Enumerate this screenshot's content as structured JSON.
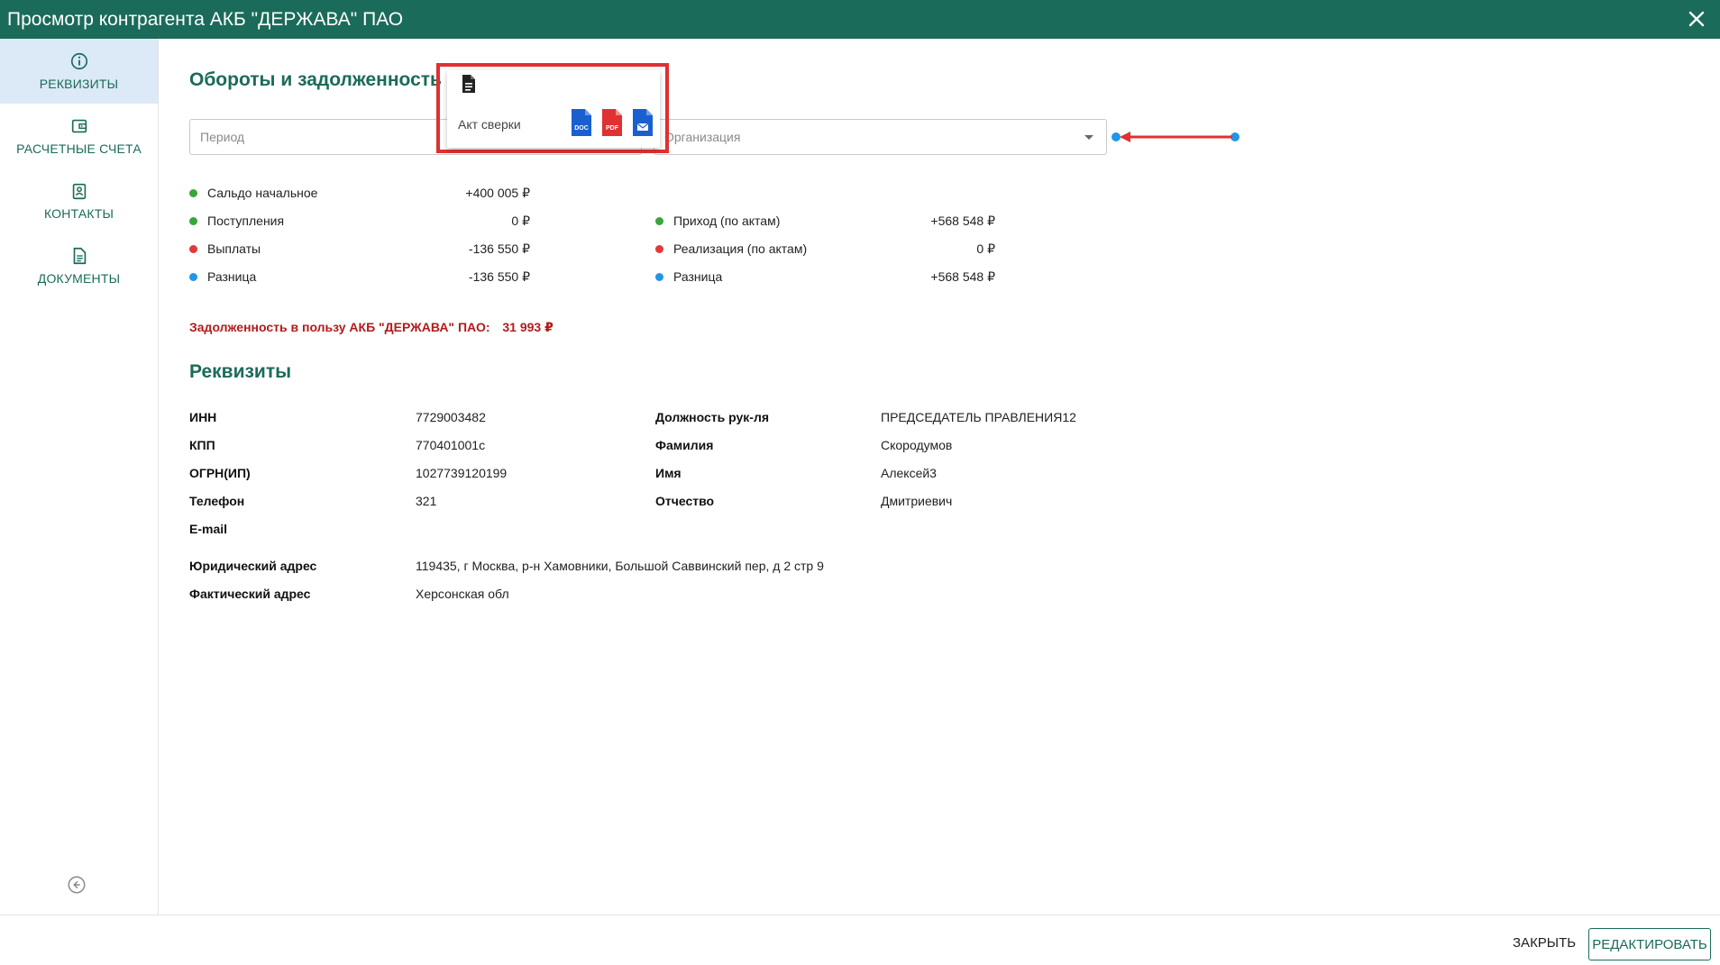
{
  "window": {
    "title": "Просмотр контрагента АКБ \"ДЕРЖАВА\" ПАО",
    "close_icon": "close-icon"
  },
  "sidebar": {
    "items": [
      {
        "label": "РЕКВИЗИТЫ",
        "icon": "info-icon",
        "active": true
      },
      {
        "label": "РАСЧЕТНЫЕ СЧЕТА",
        "icon": "wallet-icon",
        "active": false
      },
      {
        "label": "КОНТАКТЫ",
        "icon": "contact-card-icon",
        "active": false
      },
      {
        "label": "ДОКУМЕНТЫ",
        "icon": "document-icon",
        "active": false
      }
    ],
    "collapse_icon": "arrow-left-circle-icon"
  },
  "turnover": {
    "title": "Обороты и задолженность",
    "period_placeholder": "Период",
    "organization_placeholder": "Организация",
    "popover": {
      "act_label": "Акт сверки",
      "buttons": [
        {
          "name": "doc",
          "label": "DOC",
          "color": "#1a5fd0"
        },
        {
          "name": "pdf",
          "label": "PDF",
          "color": "#e03030"
        },
        {
          "name": "email",
          "label": "",
          "color": "#1a5fd0"
        }
      ]
    },
    "left_rows": [
      {
        "label": "Сальдо начальное",
        "value": "+400 005 ₽",
        "color": "#3aa63a"
      },
      {
        "label": "Поступления",
        "value": "0 ₽",
        "color": "#3aa63a"
      },
      {
        "label": "Выплаты",
        "value": "-136 550 ₽",
        "color": "#e03a3a"
      },
      {
        "label": "Разница",
        "value": "-136 550 ₽",
        "color": "#2196e8"
      }
    ],
    "right_rows": [
      {
        "label": "Приход (по актам)",
        "value": "+568 548 ₽",
        "color": "#3aa63a"
      },
      {
        "label": "Реализация (по актам)",
        "value": "0 ₽",
        "color": "#e03a3a"
      },
      {
        "label": "Разница",
        "value": "+568 548 ₽",
        "color": "#2196e8"
      }
    ],
    "debt_label": "Задолженность в пользу АКБ \"ДЕРЖАВА\" ПАО:",
    "debt_value": "31 993 ₽"
  },
  "requisites": {
    "title": "Реквизиты",
    "left": [
      {
        "label": "ИНН",
        "value": "7729003482"
      },
      {
        "label": "КПП",
        "value": "770401001с"
      },
      {
        "label": "ОГРН(ИП)",
        "value": "1027739120199"
      },
      {
        "label": "Телефон",
        "value": "321"
      },
      {
        "label": "E-mail",
        "value": ""
      }
    ],
    "right": [
      {
        "label": "Должность рук-ля",
        "value": "ПРЕДСЕДАТЕЛЬ ПРАВЛЕНИЯ12"
      },
      {
        "label": "Фамилия",
        "value": "Скородумов"
      },
      {
        "label": "Имя",
        "value": "Алексей3"
      },
      {
        "label": "Отчество",
        "value": "Дмитриевич"
      }
    ],
    "legal_address_label": "Юридический адрес",
    "legal_address_value": "119435, г Москва, р-н Хамовники, Большой Саввинский пер, д 2 стр 9",
    "actual_address_label": "Фактический адрес",
    "actual_address_value": "Херсонская обл"
  },
  "footer": {
    "close_label": "ЗАКРЫТЬ",
    "edit_label": "РЕДАКТИРОВАТЬ"
  },
  "colors": {
    "brand": "#1b6b5a",
    "active_bg": "#dce9f6",
    "annotation": "#e03030"
  }
}
